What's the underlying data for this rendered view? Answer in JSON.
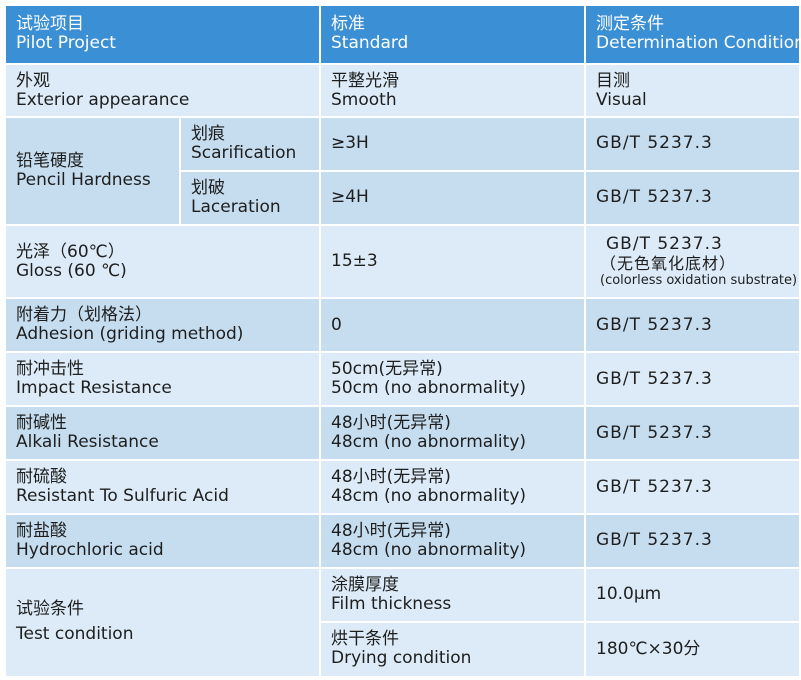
{
  "header": {
    "project_cn": "试验项目",
    "project_en": "Pilot Project",
    "standard_cn": "标准",
    "standard_en": "Standard",
    "condition_cn": "测定条件",
    "condition_en": "Determination Condition"
  },
  "rows": {
    "exterior": {
      "item_cn": "外观",
      "item_en": "Exterior appearance",
      "std_cn": "平整光滑",
      "std_en": "Smooth",
      "cond_cn": "目测",
      "cond_en": "Visual"
    },
    "pencil": {
      "item_cn": "铅笔硬度",
      "item_en": "Pencil Hardness",
      "sub1_cn": "划痕",
      "sub1_en": "Scarification",
      "sub1_std": "≥3H",
      "sub1_cond": "GB/T 5237.3",
      "sub2_cn": "划破",
      "sub2_en": "Laceration",
      "sub2_std": "≥4H",
      "sub2_cond": "GB/T 5237.3"
    },
    "gloss": {
      "item_cn": "光泽（60℃）",
      "item_en": "Gloss (60 ℃)",
      "std": "15±3",
      "cond": "GB/T 5237.3",
      "cond_note_cn": "（无色氧化底材）",
      "cond_note_en": "(colorless oxidation substrate)"
    },
    "adhesion": {
      "item_cn": "附着力（划格法）",
      "item_en": "Adhesion (griding method)",
      "std": "0",
      "cond": "GB/T 5237.3"
    },
    "impact": {
      "item_cn": "耐冲击性",
      "item_en": "Impact Resistance",
      "std_cn": "50cm(无异常)",
      "std_en": "50cm (no abnormality)",
      "cond": "GB/T 5237.3"
    },
    "alkali": {
      "item_cn": "耐碱性",
      "item_en": "Alkali Resistance",
      "std_cn": "48小时(无异常)",
      "std_en": "48cm (no abnormality)",
      "cond": "GB/T 5237.3"
    },
    "sulfuric": {
      "item_cn": "耐硫酸",
      "item_en": "Resistant To Sulfuric Acid",
      "std_cn": "48小时(无异常)",
      "std_en": "48cm (no abnormality)",
      "cond": "GB/T 5237.3"
    },
    "hydrochloric": {
      "item_cn": "耐盐酸",
      "item_en": "Hydrochloric acid",
      "std_cn": "48小时(无异常)",
      "std_en": "48cm (no abnormality)",
      "cond": "GB/T 5237.3"
    },
    "test": {
      "item_cn": "试验条件",
      "item_en": "Test condition",
      "film_cn": "涂膜厚度",
      "film_en": "Film thickness",
      "film_value": "10.0μm",
      "dry_cn": "烘干条件",
      "dry_en": "Drying condition",
      "dry_value": "180℃×30分"
    }
  },
  "colors": {
    "header_bg": "#3b8fd4",
    "row_light": "#dcebf7",
    "row_dark": "#c6ddf0"
  }
}
